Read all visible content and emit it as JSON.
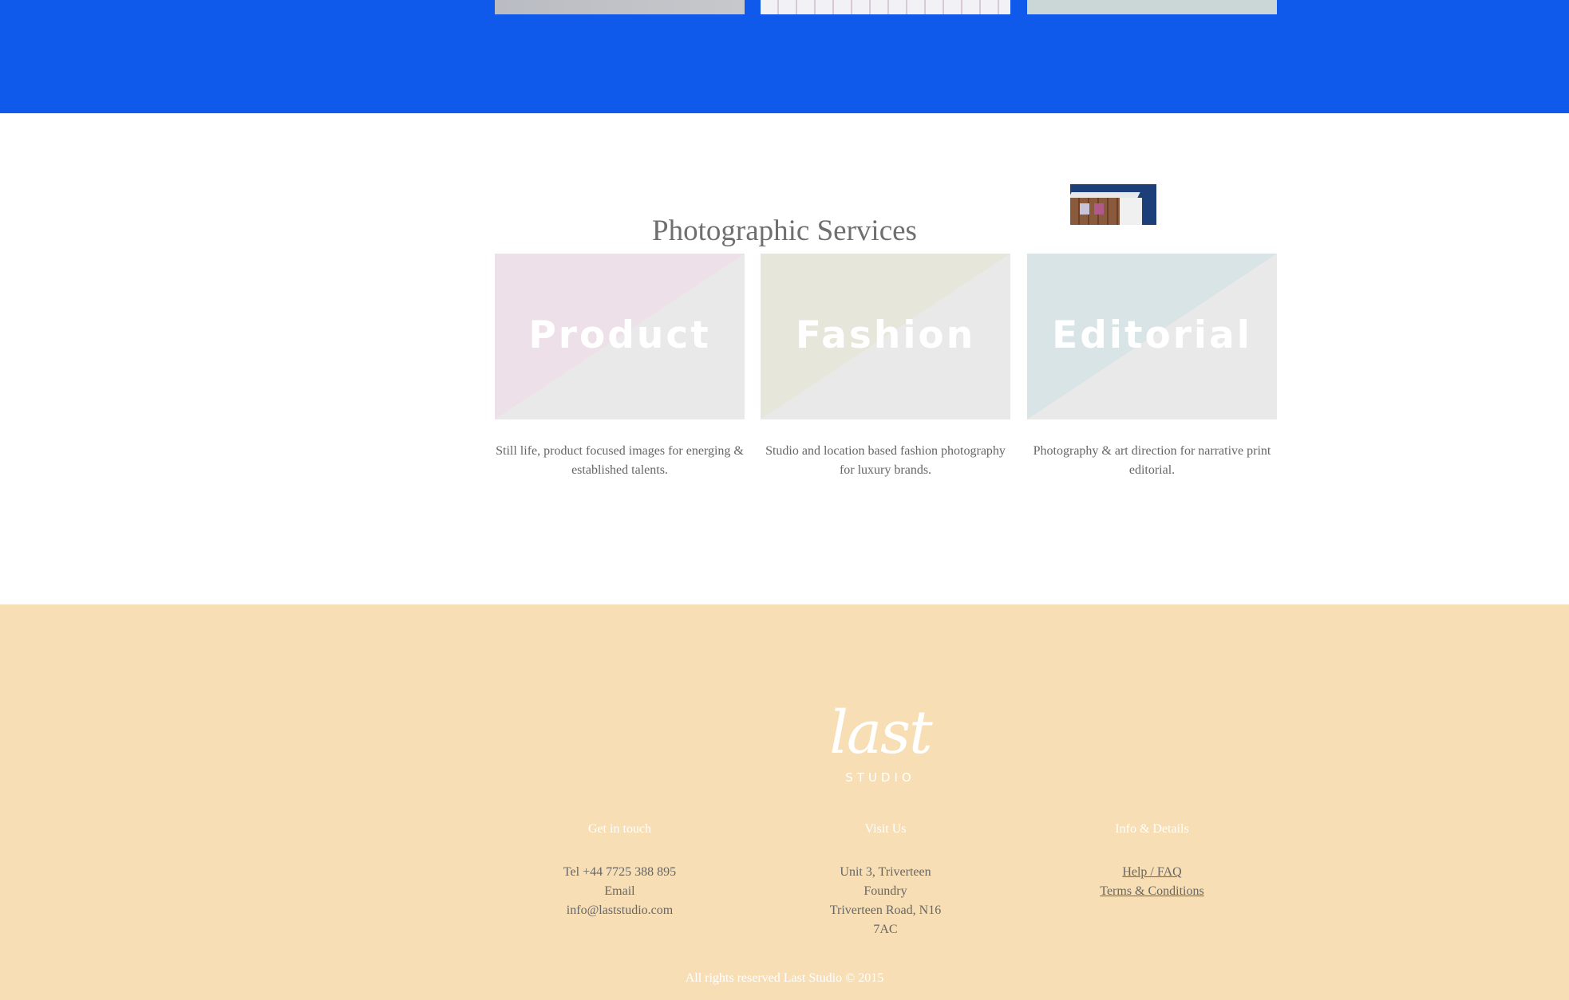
{
  "services": {
    "title": "Photographic Services",
    "cards": [
      {
        "label": "Product",
        "description": "Still life, product focused images for energing & established talents."
      },
      {
        "label": "Fashion",
        "description": "Studio and location based fashion photography for luxury brands."
      },
      {
        "label": "Editorial",
        "description": "Photography & art direction for narrative print editorial."
      }
    ]
  },
  "footer": {
    "logo": {
      "script": "last",
      "sub": "STUDIO"
    },
    "contact": {
      "heading": "Get in touch",
      "tel": "Tel +44 7725 388 895",
      "email_label": "Email",
      "email": "info@laststudio.com"
    },
    "visit": {
      "heading": "Visit Us",
      "lines": [
        "Unit 3, Triverteen",
        "Foundry",
        "Triverteen Road, N16",
        "7AC"
      ]
    },
    "info": {
      "heading": "Info & Details",
      "links": [
        "Help / FAQ",
        "Terms & Conditions"
      ]
    },
    "copyright": "All rights reserved Last Studio © 2015"
  },
  "colors": {
    "blue_band": "#0f5aeb",
    "footer_bg": "#f7deb5",
    "text": "#666666"
  }
}
